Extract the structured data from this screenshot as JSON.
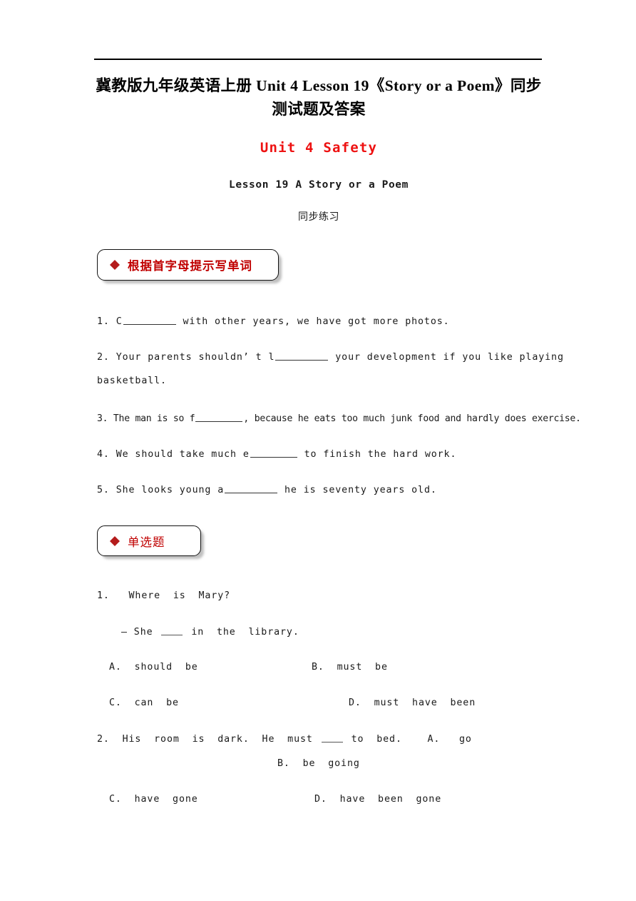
{
  "document": {
    "title_line1": "冀教版九年级英语上册 Unit 4 Lesson 19《Story or a Poem》同步",
    "title_line2": "测试题及答案",
    "unit_heading": "Unit 4 Safety",
    "lesson_heading": "Lesson 19 A Story or a Poem",
    "practice_label": "同步练习",
    "accent_red": "#ee1111",
    "accent_crimson": "#c00000"
  },
  "sections": [
    {
      "id": "word-formation",
      "label": "根据首字母提示写单词",
      "bullet": "diamond-bullet",
      "bold": true
    },
    {
      "id": "multiple-choice",
      "label": "单选题",
      "bullet": "diamond-bullet",
      "bold": false
    }
  ],
  "fill_in_blanks": {
    "q1": {
      "number": "1.",
      "pre": "C",
      "post": " with other years, we have got more photos."
    },
    "q2": {
      "number": "2.",
      "pre": "Your parents shouldn’ t l",
      "post": " your development if you like playing",
      "continuation": "basketball."
    },
    "q3": {
      "number": "3.",
      "pre": "The man is so f",
      "post": ", because he eats too much junk food and hardly does exercise."
    },
    "q4": {
      "number": "4.",
      "pre": "We should take much e",
      "post": " to finish the hard work."
    },
    "q5": {
      "number": "5.",
      "pre": "She looks young a",
      "post": " he is seventy years old."
    }
  },
  "multiple_choice": {
    "q1": {
      "number": "1.",
      "stem": "Where  is  Mary?",
      "answer_pre": "— She ",
      "answer_post": " in  the  library.",
      "option_a": "A.  should  be",
      "option_b": "B.  must  be",
      "option_c": "C.  can  be",
      "option_d": "D.  must  have  been"
    },
    "q2": {
      "number": "2.",
      "stem_pre": "His  room  is  dark.  He  must ",
      "stem_post": " to  bed.",
      "option_a": "A.   go",
      "option_b": "B.  be  going",
      "option_c": "C.  have  gone",
      "option_d": "D.  have  been  gone"
    }
  }
}
